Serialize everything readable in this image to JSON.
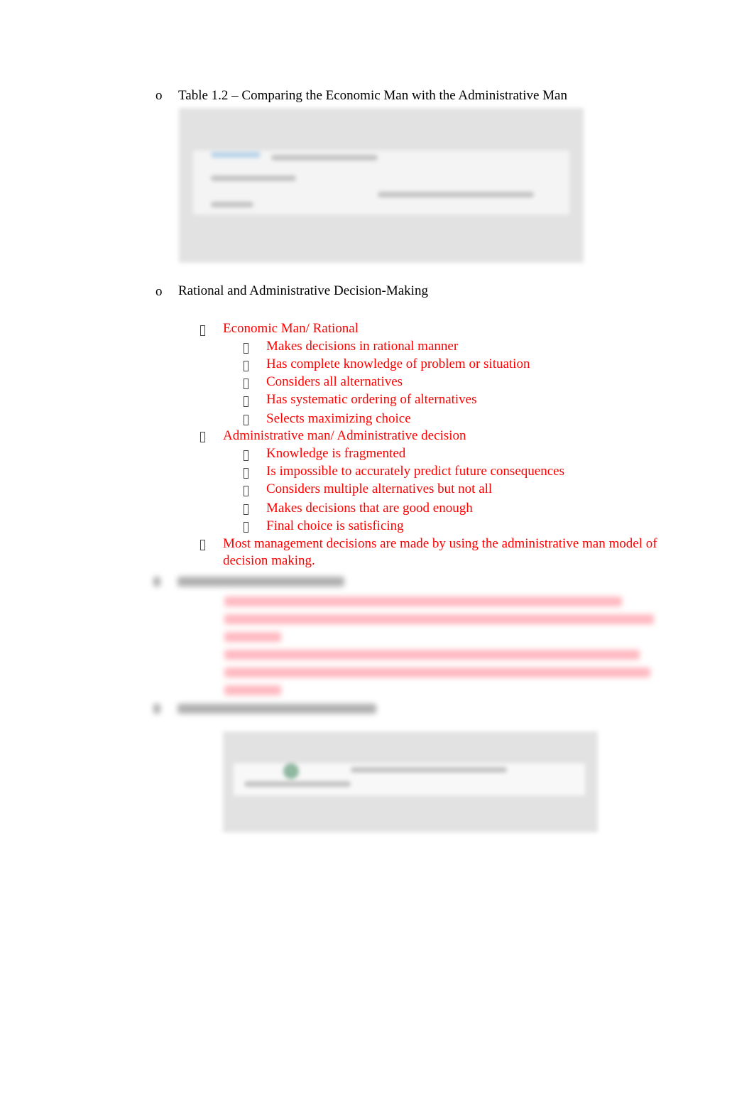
{
  "section1": {
    "bullet_icon": "circle-o-bullet",
    "title": "Table 1.2 – Comparing the Economic Man with the Administrative Man"
  },
  "section2": {
    "bullet_icon": "circle-o-bullet",
    "title": "Rational and Administrative Decision-Making",
    "sub_bullet_icon": "missing-glyph-box-bullet",
    "text_color": "#ff0000",
    "groups": [
      {
        "label": "Economic Man/ Rational",
        "items": [
          "Makes decisions in rational manner",
          "Has complete knowledge of problem or situation",
          "Considers all alternatives",
          "Has systematic ordering of alternatives",
          "Selects maximizing choice"
        ]
      },
      {
        "label": "Administrative man/ Administrative decision",
        "items": [
          "Knowledge is fragmented",
          "Is impossible to accurately predict future consequences",
          "Considers multiple alternatives but not all",
          "Makes decisions that are good enough",
          "Final choice is satisficing"
        ]
      }
    ],
    "conclusion_line1": "Most management decisions are made by using the administrative man model of",
    "conclusion_line2": "decision making."
  }
}
